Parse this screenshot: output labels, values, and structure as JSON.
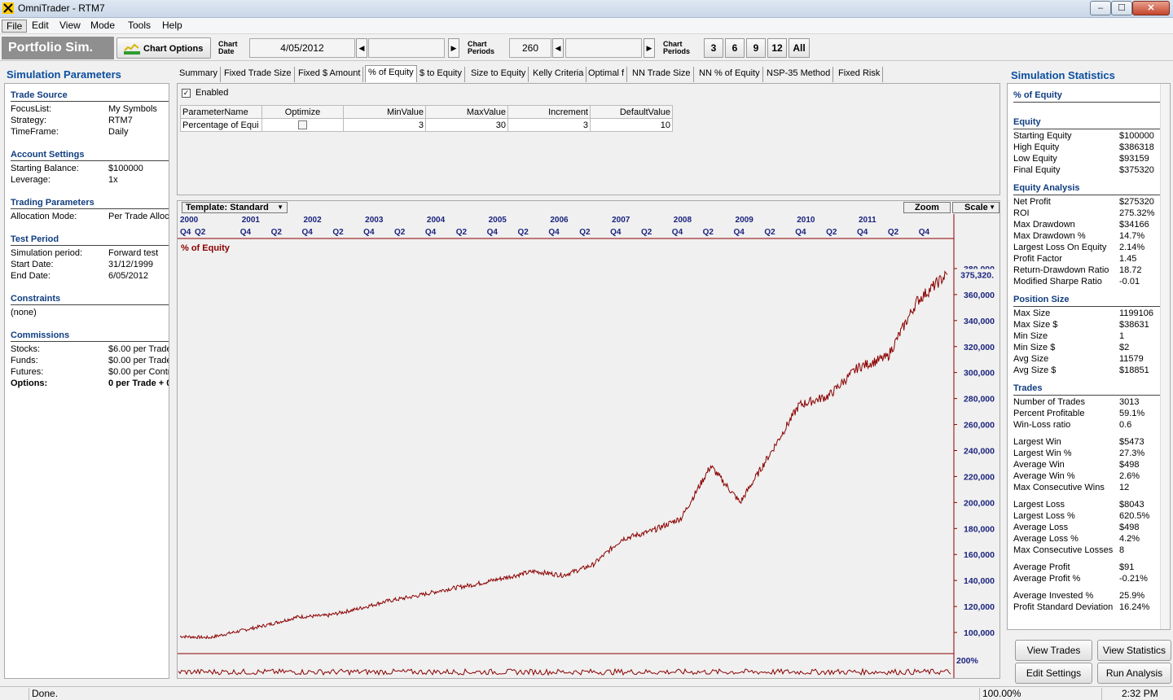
{
  "window": {
    "title": "OmniTrader - RTM7",
    "min": "–",
    "max": "☐",
    "close": "✕"
  },
  "menu": [
    "File",
    "Edit",
    "View",
    "Mode",
    "Tools",
    "Help"
  ],
  "toolbar": {
    "mode_title": "Portfolio Sim.",
    "chart_options": "Chart Options",
    "chart_date_label": [
      "Chart",
      "Date"
    ],
    "chart_date": "4/05/2012",
    "chart_periods_label": [
      "Chart",
      "Periods"
    ],
    "chart_periods": "260",
    "chart_periods_label2": [
      "Chart",
      "Periods"
    ],
    "periods": [
      "3",
      "6",
      "9",
      "12",
      "All"
    ]
  },
  "left": {
    "title": "Simulation Parameters",
    "sections": [
      {
        "head": "Trade Source",
        "rows": [
          [
            "FocusList:",
            "My Symbols"
          ],
          [
            "Strategy:",
            "RTM7"
          ],
          [
            "TimeFrame:",
            "Daily"
          ]
        ]
      },
      {
        "head": "Account Settings",
        "rows": [
          [
            "Starting Balance:",
            "$100000"
          ],
          [
            "Leverage:",
            "1x"
          ]
        ]
      },
      {
        "head": "Trading Parameters",
        "rows": [
          [
            "Allocation Mode:",
            "Per Trade Alloc"
          ]
        ]
      },
      {
        "head": "Test Period",
        "rows": [
          [
            "Simulation period:",
            "Forward test"
          ],
          [
            "Start Date:",
            "31/12/1999"
          ],
          [
            "End Date:",
            "6/05/2012"
          ]
        ]
      },
      {
        "head": "Constraints",
        "rows": [
          [
            "(none)",
            ""
          ]
        ]
      },
      {
        "head": "Commissions",
        "rows": [
          [
            "Stocks:",
            "$6.00 per Trade"
          ],
          [
            "Funds:",
            "$0.00 per Trade"
          ],
          [
            "Futures:",
            "$0.00 per Contr"
          ],
          [
            "Options:",
            "0 per Trade + 0"
          ]
        ]
      }
    ]
  },
  "tabs": [
    "Summary",
    "Fixed Trade Size",
    "Fixed $ Amount",
    "% of Equity",
    "$ to Equity",
    "Size to Equity",
    "Kelly Criteria",
    "Optimal f",
    "NN Trade Size",
    "NN % of Equity",
    "NSP-35 Method",
    "Fixed Risk"
  ],
  "active_tab": "% of Equity",
  "params": {
    "enabled_label": "Enabled",
    "columns": [
      "ParameterName",
      "Optimize",
      "MinValue",
      "MaxValue",
      "Increment",
      "DefaultValue"
    ],
    "rows": [
      [
        "Percentage of Equi",
        "",
        "3",
        "30",
        "3",
        "10"
      ]
    ]
  },
  "chart": {
    "template": "Template: Standard",
    "zoom": "Zoom",
    "scale": "Scale",
    "series_label": "% of Equity",
    "years": [
      "2000",
      "2001",
      "2002",
      "2003",
      "2004",
      "2005",
      "2006",
      "2007",
      "2008",
      "2009",
      "2010",
      "2011"
    ],
    "quarters": [
      "Q4",
      "Q2",
      "Q4",
      "Q2",
      "Q4",
      "Q2",
      "Q4",
      "Q2",
      "Q4",
      "Q2",
      "Q4",
      "Q2",
      "Q4",
      "Q2",
      "Q4",
      "Q2",
      "Q4",
      "Q2",
      "Q4",
      "Q2",
      "Q4",
      "Q2",
      "Q4",
      "Q2",
      "Q4"
    ],
    "last_value_label": "375,320.",
    "lower_pane_label": "200%",
    "line_color": "#8b0000",
    "axis_color": "#1a237e"
  },
  "chart_data": {
    "type": "line",
    "title": "% of Equity",
    "ylim": [
      90000,
      390000
    ],
    "yticks": [
      "380,000",
      "360,000",
      "340,000",
      "320,000",
      "300,000",
      "280,000",
      "260,000",
      "240,000",
      "220,000",
      "200,000",
      "180,000",
      "160,000",
      "140,000",
      "120,000",
      "100,000"
    ],
    "x": [
      "2000-01",
      "2000-07",
      "2001-01",
      "2001-07",
      "2002-01",
      "2002-07",
      "2003-01",
      "2003-07",
      "2004-01",
      "2004-07",
      "2005-01",
      "2005-07",
      "2006-01",
      "2006-07",
      "2007-01",
      "2007-07",
      "2008-01",
      "2008-07",
      "2009-01",
      "2009-04",
      "2009-07",
      "2010-01",
      "2010-07",
      "2011-01",
      "2011-07",
      "2012-01",
      "2012-05"
    ],
    "series": [
      {
        "values": [
          97000,
          96000,
          101000,
          106000,
          112000,
          113000,
          118000,
          124000,
          128000,
          133000,
          137000,
          142000,
          147000,
          144000,
          152000,
          172000,
          178000,
          188000,
          228000,
          200000,
          237000,
          275000,
          282000,
          304000,
          312000,
          355000,
          375320
        ]
      }
    ]
  },
  "right": {
    "title": "Simulation Statistics",
    "sections": [
      {
        "head": "% of Equity",
        "rows": []
      },
      {
        "head": "Equity",
        "rows": [
          [
            "Starting Equity",
            "$100000"
          ],
          [
            "High Equity",
            "$386318"
          ],
          [
            "Low Equity",
            "$93159"
          ],
          [
            "Final Equity",
            "$375320"
          ]
        ]
      },
      {
        "head": "Equity Analysis",
        "rows": [
          [
            "Net Profit",
            "$275320"
          ],
          [
            "ROI",
            "275.32%"
          ],
          [
            "Max Drawdown",
            "$34166"
          ],
          [
            "Max Drawdown %",
            "14.7%"
          ],
          [
            "Largest Loss On Equity",
            "2.14%"
          ],
          [
            "Profit Factor",
            "1.45"
          ],
          [
            "Return-Drawdown Ratio",
            "18.72"
          ],
          [
            "Modified Sharpe Ratio",
            "-0.01"
          ]
        ]
      },
      {
        "head": "Position Size",
        "rows": [
          [
            "Max Size",
            "1199106"
          ],
          [
            "Max Size $",
            "$38631"
          ],
          [
            "Min Size",
            "1"
          ],
          [
            "Min Size $",
            "$2"
          ],
          [
            "Avg Size",
            "11579"
          ],
          [
            "Avg Size $",
            "$18851"
          ]
        ]
      },
      {
        "head": "Trades",
        "rows": [
          [
            "Number of Trades",
            "3013"
          ],
          [
            "Percent Profitable",
            "59.1%"
          ],
          [
            "Win-Loss ratio",
            "0.6"
          ],
          [
            "",
            ""
          ],
          [
            "Largest Win",
            "$5473"
          ],
          [
            "Largest Win %",
            "27.3%"
          ],
          [
            "Average Win",
            "$498"
          ],
          [
            "Average Win %",
            "2.6%"
          ],
          [
            "Max Consecutive Wins",
            "12"
          ],
          [
            "",
            ""
          ],
          [
            "Largest Loss",
            "$8043"
          ],
          [
            "Largest Loss %",
            "620.5%"
          ],
          [
            "Average Loss",
            "$498"
          ],
          [
            "Average Loss %",
            "4.2%"
          ],
          [
            "Max Consecutive Losses",
            "8"
          ],
          [
            "",
            ""
          ],
          [
            "Average Profit",
            "$91"
          ],
          [
            "Average Profit %",
            "-0.21%"
          ],
          [
            "",
            ""
          ],
          [
            "Average Invested %",
            "25.9%"
          ],
          [
            "Profit Standard Deviation",
            "16.24%"
          ]
        ]
      }
    ],
    "buttons": [
      "View Trades",
      "View Statistics",
      "Edit Settings",
      "Run Analysis"
    ]
  },
  "status": {
    "text": "Done.",
    "zoom": "100.00%",
    "time": "2:32 PM"
  }
}
